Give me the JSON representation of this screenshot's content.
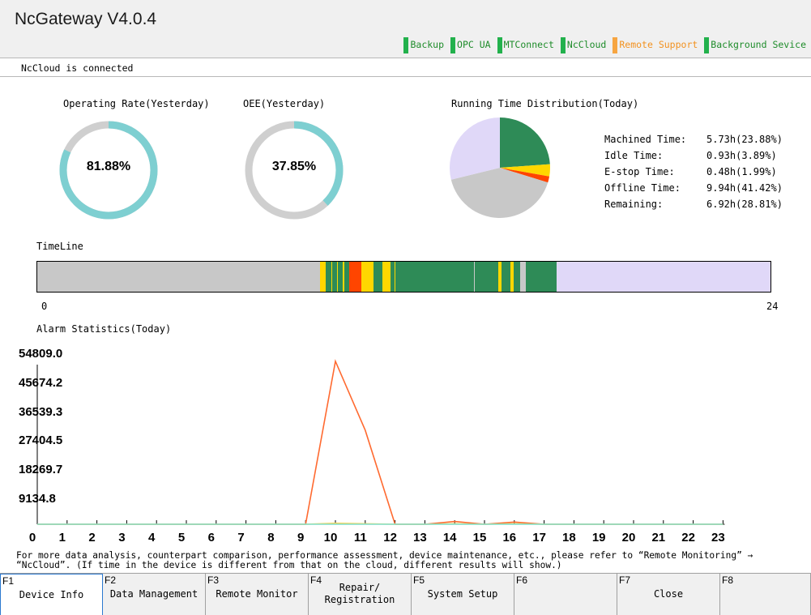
{
  "header": {
    "title": "NcGateway V4.0.4",
    "services": [
      {
        "label": "Backup",
        "color": "green"
      },
      {
        "label": "OPC UA",
        "color": "green"
      },
      {
        "label": "MTConnect",
        "color": "green"
      },
      {
        "label": "NcCloud",
        "color": "green"
      },
      {
        "label": "Remote Support",
        "color": "orange"
      },
      {
        "label": "Background Sevice",
        "color": "green"
      }
    ]
  },
  "status": "NcCloud is connected",
  "operating_rate": {
    "label": "Operating Rate(Yesterday)",
    "value": "81.88%",
    "fraction": 0.8188
  },
  "oee": {
    "label": "OEE(Yesterday)",
    "value": "37.85%",
    "fraction": 0.3785
  },
  "running_time": {
    "label": "Running Time Distribution(Today)",
    "items": [
      {
        "name": "Machined Time:",
        "value": "5.73h(23.88%)",
        "percent": 23.88,
        "color": "#2e8b57"
      },
      {
        "name": "Idle Time:",
        "value": "0.93h(3.89%)",
        "percent": 3.89,
        "color": "#ffd700"
      },
      {
        "name": "E-stop Time:",
        "value": "0.48h(1.99%)",
        "percent": 1.99,
        "color": "#ff4500"
      },
      {
        "name": "Offline Time:",
        "value": "9.94h(41.42%)",
        "percent": 41.42,
        "color": "#c8c8c8"
      },
      {
        "name": "Remaining:",
        "value": "6.92h(28.81%)",
        "percent": 28.81,
        "color": "#e0d8f8"
      }
    ]
  },
  "timeline": {
    "label": "TimeLine",
    "start_label": "0",
    "end_label": "24",
    "hours": 24,
    "segments": [
      {
        "start": 0.0,
        "end": 9.25,
        "color": "#c8c8c8"
      },
      {
        "start": 9.25,
        "end": 9.45,
        "color": "#ffd700"
      },
      {
        "start": 9.45,
        "end": 10.2,
        "color": "#2e8b57"
      },
      {
        "start": 9.62,
        "end": 9.66,
        "color": "#ffd700"
      },
      {
        "start": 9.8,
        "end": 9.84,
        "color": "#ffd700"
      },
      {
        "start": 10.0,
        "end": 10.04,
        "color": "#ffd700"
      },
      {
        "start": 10.2,
        "end": 10.6,
        "color": "#ff4500"
      },
      {
        "start": 10.6,
        "end": 11.0,
        "color": "#ffd700"
      },
      {
        "start": 11.0,
        "end": 11.3,
        "color": "#2e8b57"
      },
      {
        "start": 11.3,
        "end": 11.55,
        "color": "#ffd700"
      },
      {
        "start": 11.55,
        "end": 15.1,
        "color": "#2e8b57"
      },
      {
        "start": 11.7,
        "end": 11.73,
        "color": "#ffd700"
      },
      {
        "start": 14.3,
        "end": 14.32,
        "color": "#c8c8c8"
      },
      {
        "start": 15.1,
        "end": 15.2,
        "color": "#ffd700"
      },
      {
        "start": 15.2,
        "end": 15.5,
        "color": "#2e8b57"
      },
      {
        "start": 15.5,
        "end": 15.6,
        "color": "#ffd700"
      },
      {
        "start": 15.6,
        "end": 15.8,
        "color": "#2e8b57"
      },
      {
        "start": 15.8,
        "end": 16.0,
        "color": "#c8c8c8"
      },
      {
        "start": 16.0,
        "end": 17.0,
        "color": "#2e8b57"
      },
      {
        "start": 17.0,
        "end": 24.0,
        "color": "#e0d8f8"
      }
    ]
  },
  "alarm": {
    "label": "Alarm Statistics(Today)",
    "y_ticks": [
      "54809.0",
      "45674.2",
      "36539.3",
      "27404.5",
      "18269.7",
      "9134.8"
    ],
    "x_ticks": [
      "0",
      "1",
      "2",
      "3",
      "4",
      "5",
      "6",
      "7",
      "8",
      "9",
      "10",
      "11",
      "12",
      "13",
      "14",
      "15",
      "16",
      "17",
      "18",
      "19",
      "20",
      "21",
      "22",
      "23"
    ]
  },
  "chart_data": {
    "type": "line",
    "title": "Alarm Statistics(Today)",
    "x": [
      0,
      1,
      2,
      3,
      4,
      5,
      6,
      7,
      8,
      9,
      10,
      11,
      12,
      13,
      14,
      15,
      16,
      17,
      18,
      19,
      20,
      21,
      22,
      23
    ],
    "ylim": [
      0,
      54809.0
    ],
    "series": [
      {
        "color": "#ff6a30",
        "values": [
          0,
          0,
          0,
          0,
          0,
          0,
          0,
          0,
          0,
          0,
          52000,
          30000,
          0,
          0,
          900,
          0,
          700,
          0,
          0,
          0,
          0,
          0,
          0,
          0
        ]
      },
      {
        "color": "#ffd24a",
        "values": [
          0,
          0,
          0,
          0,
          0,
          0,
          0,
          0,
          0,
          0,
          300,
          150,
          0,
          0,
          150,
          0,
          150,
          0,
          0,
          0,
          0,
          0,
          0,
          0
        ]
      },
      {
        "color": "#7fdfd0",
        "values": [
          0,
          0,
          0,
          0,
          0,
          0,
          0,
          0,
          0,
          0,
          0,
          0,
          0,
          0,
          0,
          0,
          0,
          0,
          0,
          0,
          0,
          0,
          0,
          0
        ]
      }
    ]
  },
  "info_text": "For more data analysis, counterpart comparison, performance assessment, device maintenance, etc., please refer to “Remote Monitoring” → “NcCloud”. (If time in the device is different from that on the cloud, different results will show.)",
  "fkeys": [
    {
      "num": "F1",
      "label": "Device Info",
      "active": true
    },
    {
      "num": "F2",
      "label": "Data Management",
      "active": false
    },
    {
      "num": "F3",
      "label": "Remote Monitor",
      "active": false
    },
    {
      "num": "F4",
      "label": "Repair/\nRegistration",
      "active": false
    },
    {
      "num": "F5",
      "label": "System Setup",
      "active": false
    },
    {
      "num": "F6",
      "label": "",
      "active": false
    },
    {
      "num": "F7",
      "label": "Close",
      "active": false
    },
    {
      "num": "F8",
      "label": "",
      "active": false
    }
  ],
  "colors": {
    "gauge_fill": "#7ecfd1",
    "gauge_track": "#cfcfcf"
  }
}
